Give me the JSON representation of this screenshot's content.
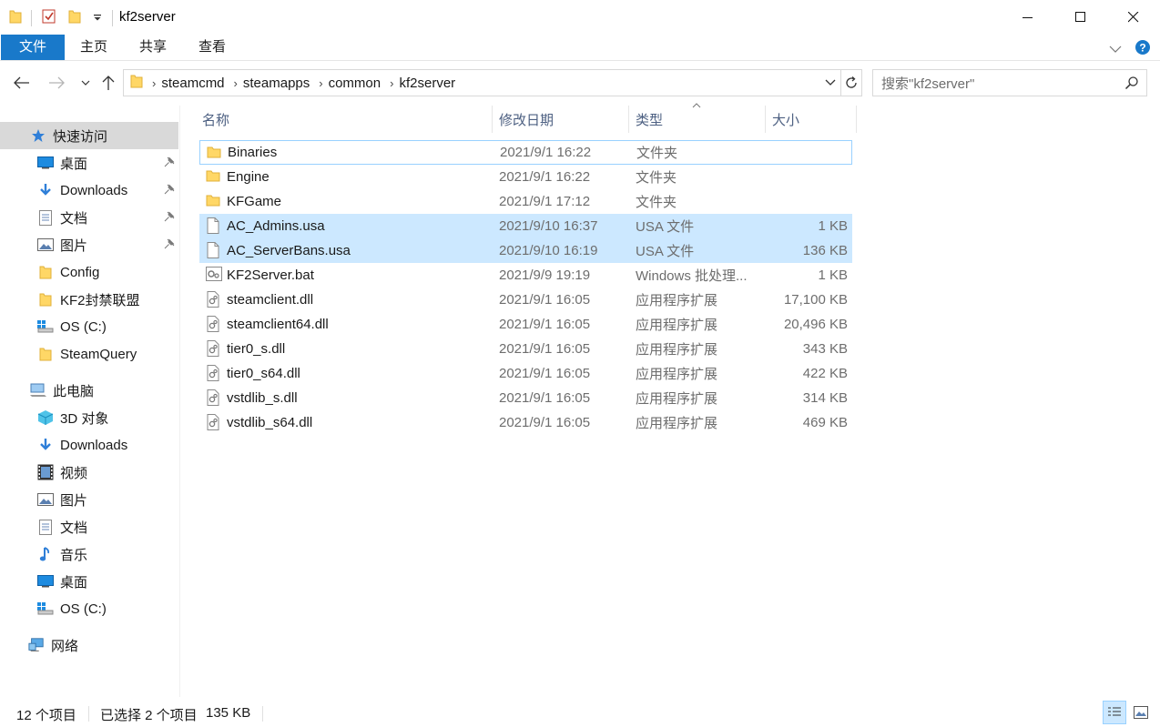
{
  "window": {
    "title": "kf2server",
    "colors": {
      "accent": "#1979ca",
      "selection": "#cce8ff",
      "selection_border": "#99d1ff",
      "folder": "#ffd766"
    }
  },
  "ribbon": {
    "tabs": [
      {
        "label": "文件"
      },
      {
        "label": "主页"
      },
      {
        "label": "共享"
      },
      {
        "label": "查看"
      }
    ]
  },
  "address": {
    "crumbs": [
      "steamcmd",
      "steamapps",
      "common",
      "kf2server"
    ],
    "search_placeholder": "搜索\"kf2server\""
  },
  "sidebar": {
    "items": [
      {
        "label": "快速访问",
        "icon": "star-icon",
        "pinned": false
      },
      {
        "label": "桌面",
        "icon": "desktop-icon",
        "pinned": true
      },
      {
        "label": "Downloads",
        "icon": "download-icon",
        "pinned": true
      },
      {
        "label": "文档",
        "icon": "document-icon",
        "pinned": true
      },
      {
        "label": "图片",
        "icon": "picture-icon",
        "pinned": true
      },
      {
        "label": "Config",
        "icon": "folder-icon",
        "pinned": false
      },
      {
        "label": "KF2封禁联盟",
        "icon": "folder-icon",
        "pinned": false
      },
      {
        "label": "OS (C:)",
        "icon": "drive-icon",
        "pinned": false
      },
      {
        "label": "SteamQuery",
        "icon": "folder-icon",
        "pinned": false
      },
      {
        "label": "此电脑",
        "icon": "computer-icon",
        "pinned": false
      },
      {
        "label": "3D 对象",
        "icon": "3d-objects-icon",
        "pinned": false
      },
      {
        "label": "Downloads",
        "icon": "download-icon",
        "pinned": false
      },
      {
        "label": "视频",
        "icon": "video-icon",
        "pinned": false
      },
      {
        "label": "图片",
        "icon": "picture-icon",
        "pinned": false
      },
      {
        "label": "文档",
        "icon": "document-icon",
        "pinned": false
      },
      {
        "label": "音乐",
        "icon": "music-icon",
        "pinned": false
      },
      {
        "label": "桌面",
        "icon": "desktop-icon",
        "pinned": false
      },
      {
        "label": "OS (C:)",
        "icon": "drive-icon",
        "pinned": false
      },
      {
        "label": "网络",
        "icon": "network-icon",
        "pinned": false
      }
    ]
  },
  "columns": {
    "name": "名称",
    "date": "修改日期",
    "type": "类型",
    "size": "大小"
  },
  "files": [
    {
      "name": "Binaries",
      "date": "2021/9/1 16:22",
      "type": "文件夹",
      "size": "",
      "icon": "folder-icon",
      "selected": false,
      "focused": true
    },
    {
      "name": "Engine",
      "date": "2021/9/1 16:22",
      "type": "文件夹",
      "size": "",
      "icon": "folder-icon",
      "selected": false,
      "focused": false
    },
    {
      "name": "KFGame",
      "date": "2021/9/1 17:12",
      "type": "文件夹",
      "size": "",
      "icon": "folder-icon",
      "selected": false,
      "focused": false
    },
    {
      "name": "AC_Admins.usa",
      "date": "2021/9/10 16:37",
      "type": "USA 文件",
      "size": "1 KB",
      "icon": "file-icon",
      "selected": true,
      "focused": false
    },
    {
      "name": "AC_ServerBans.usa",
      "date": "2021/9/10 16:19",
      "type": "USA 文件",
      "size": "136 KB",
      "icon": "file-icon",
      "selected": true,
      "focused": false
    },
    {
      "name": "KF2Server.bat",
      "date": "2021/9/9 19:19",
      "type": "Windows 批处理...",
      "size": "1 KB",
      "icon": "batch-file-icon",
      "selected": false,
      "focused": false
    },
    {
      "name": "steamclient.dll",
      "date": "2021/9/1 16:05",
      "type": "应用程序扩展",
      "size": "17,100 KB",
      "icon": "dll-file-icon",
      "selected": false,
      "focused": false
    },
    {
      "name": "steamclient64.dll",
      "date": "2021/9/1 16:05",
      "type": "应用程序扩展",
      "size": "20,496 KB",
      "icon": "dll-file-icon",
      "selected": false,
      "focused": false
    },
    {
      "name": "tier0_s.dll",
      "date": "2021/9/1 16:05",
      "type": "应用程序扩展",
      "size": "343 KB",
      "icon": "dll-file-icon",
      "selected": false,
      "focused": false
    },
    {
      "name": "tier0_s64.dll",
      "date": "2021/9/1 16:05",
      "type": "应用程序扩展",
      "size": "422 KB",
      "icon": "dll-file-icon",
      "selected": false,
      "focused": false
    },
    {
      "name": "vstdlib_s.dll",
      "date": "2021/9/1 16:05",
      "type": "应用程序扩展",
      "size": "314 KB",
      "icon": "dll-file-icon",
      "selected": false,
      "focused": false
    },
    {
      "name": "vstdlib_s64.dll",
      "date": "2021/9/1 16:05",
      "type": "应用程序扩展",
      "size": "469 KB",
      "icon": "dll-file-icon",
      "selected": false,
      "focused": false
    }
  ],
  "status": {
    "count": "12 个项目",
    "selection": "已选择 2 个项目",
    "selection_size": "135 KB"
  }
}
